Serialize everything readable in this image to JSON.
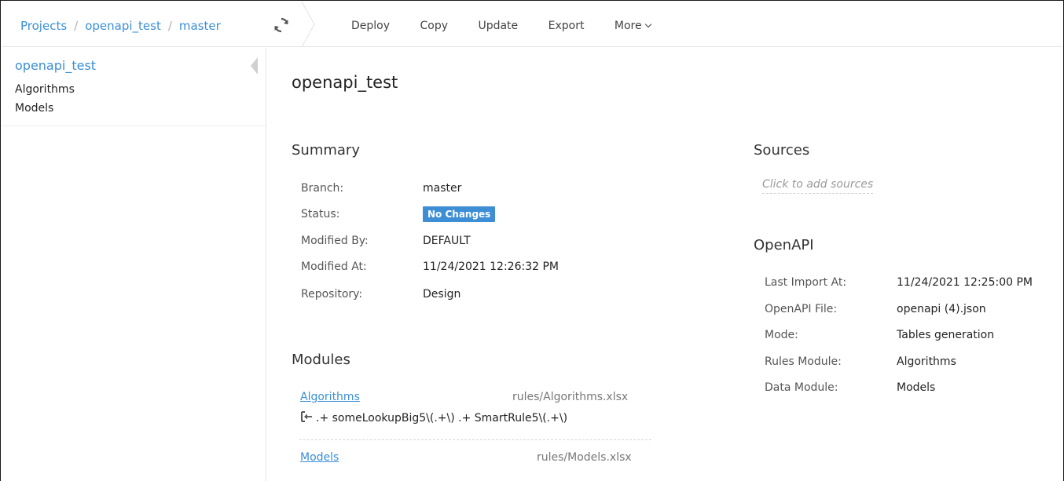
{
  "breadcrumb": {
    "projects": "Projects",
    "project": "openapi_test",
    "branch": "master",
    "sep": "/"
  },
  "toolbar": {
    "deploy": "Deploy",
    "copy": "Copy",
    "update": "Update",
    "export": "Export",
    "more": "More"
  },
  "icons": {
    "refresh": "refresh-icon",
    "collapse": "collapse-triangle-icon",
    "import": "import-arrow-icon"
  },
  "sidebar": {
    "project_title": "openapi_test",
    "items": [
      {
        "label": "Algorithms"
      },
      {
        "label": "Models"
      }
    ]
  },
  "main": {
    "title": "openapi_test",
    "summary": {
      "heading": "Summary",
      "rows": [
        {
          "label": "Branch:",
          "value": "master"
        },
        {
          "label": "Status:",
          "value": "No Changes"
        },
        {
          "label": "Modified By:",
          "value": "DEFAULT"
        },
        {
          "label": "Modified At:",
          "value": "11/24/2021 12:26:32 PM"
        },
        {
          "label": "Repository:",
          "value": "Design"
        }
      ]
    },
    "modules": {
      "heading": "Modules",
      "items": [
        {
          "name": "Algorithms",
          "path": "rules/Algorithms.xlsx",
          "pattern": ".+ someLookupBig5\\(.+\\) .+ SmartRule5\\(.+\\)"
        },
        {
          "name": "Models",
          "path": "rules/Models.xlsx"
        }
      ]
    },
    "sources": {
      "heading": "Sources",
      "placeholder": "Click to add sources"
    },
    "openapi": {
      "heading": "OpenAPI",
      "rows": [
        {
          "label": "Last Import At:",
          "value": "11/24/2021 12:25:00 PM"
        },
        {
          "label": "OpenAPI File:",
          "value": "openapi (4).json"
        },
        {
          "label": "Mode:",
          "value": "Tables generation"
        },
        {
          "label": "Rules Module:",
          "value": "Algorithms"
        },
        {
          "label": "Data Module:",
          "value": "Models"
        }
      ]
    }
  },
  "colors": {
    "link": "#3a8fd6",
    "badge": "#3e8ed6"
  }
}
